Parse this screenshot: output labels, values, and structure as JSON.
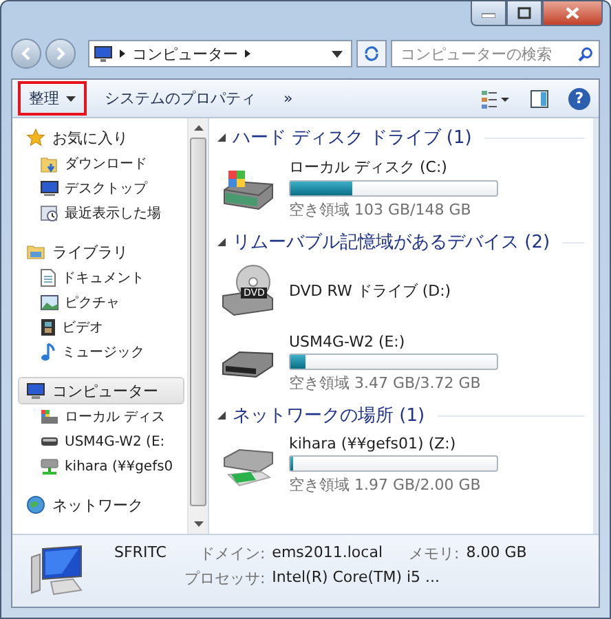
{
  "address": {
    "path": "コンピューター",
    "search_placeholder": "コンピューターの検索"
  },
  "toolbar": {
    "items": [
      {
        "label": "整理",
        "dropdown": true,
        "highlighted": true
      },
      {
        "label": "システムのプロパティ",
        "dropdown": false,
        "highlighted": false
      },
      {
        "label": "»",
        "dropdown": false,
        "highlighted": false
      }
    ],
    "help": "?"
  },
  "sidebar": {
    "groups": [
      {
        "label": "お気に入り",
        "kind": "star",
        "selected": false,
        "children": [
          {
            "label": "ダウンロード",
            "kind": "download"
          },
          {
            "label": "デスクトップ",
            "kind": "desktop"
          },
          {
            "label": "最近表示した場",
            "kind": "recent"
          }
        ]
      },
      {
        "label": "ライブラリ",
        "kind": "library",
        "selected": false,
        "children": [
          {
            "label": "ドキュメント",
            "kind": "document"
          },
          {
            "label": "ピクチャ",
            "kind": "picture"
          },
          {
            "label": "ビデオ",
            "kind": "video"
          },
          {
            "label": "ミュージック",
            "kind": "music"
          }
        ]
      },
      {
        "label": "コンピューター",
        "kind": "computer",
        "selected": true,
        "children": [
          {
            "label": "ローカル ディス",
            "kind": "disk"
          },
          {
            "label": "USM4G-W2 (E:",
            "kind": "usb"
          },
          {
            "label": "kihara (¥¥gefs0",
            "kind": "netdrive"
          }
        ]
      },
      {
        "label": "ネットワーク",
        "kind": "network",
        "selected": false
      }
    ]
  },
  "sections": [
    {
      "title": "ハード ディスク ドライブ (1)",
      "drives": [
        {
          "kind": "disk",
          "name": "ローカル ディスク (C:)",
          "level": 0.3,
          "free": "空き領域 103 GB/148 GB"
        }
      ]
    },
    {
      "title": "リムーバブル記憶域があるデバイス (2)",
      "drives": [
        {
          "kind": "dvd",
          "name": "DVD RW ドライブ (D:)",
          "icon_text": "DVD"
        },
        {
          "kind": "usb",
          "name": "USM4G-W2 (E:)",
          "level": 0.07,
          "free": "空き領域 3.47 GB/3.72 GB"
        }
      ]
    },
    {
      "title": "ネットワークの場所 (1)",
      "drives": [
        {
          "kind": "netdrive",
          "name": "kihara (¥¥gefs01) (Z:)",
          "level": 0.015,
          "free": "空き領域 1.97 GB/2.00 GB"
        }
      ]
    }
  ],
  "details": {
    "name": "SFRITC",
    "domain_label": "ドメイン:",
    "domain": "ems2011.local",
    "memory_label": "メモリ:",
    "memory": "8.00 GB",
    "cpu_label": "プロセッサ:",
    "cpu": "Intel(R) Core(TM) i5 ..."
  }
}
